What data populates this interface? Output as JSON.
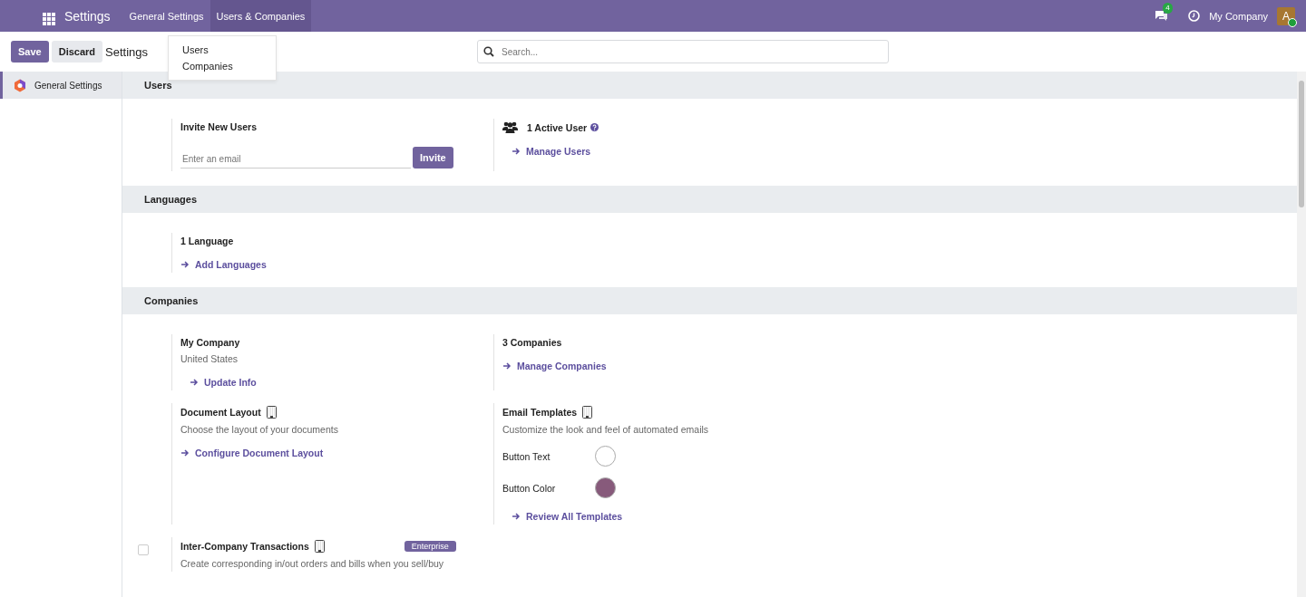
{
  "navbar": {
    "app_title": "Settings",
    "menu": [
      {
        "label": "General Settings",
        "selected": false
      },
      {
        "label": "Users & Companies",
        "selected": true
      }
    ],
    "messages_badge": "4",
    "company": "My Company",
    "avatar": "A",
    "online": true
  },
  "dropdown": {
    "items": [
      "Users",
      "Companies"
    ]
  },
  "control_panel": {
    "buttons": [
      {
        "label": "Save",
        "kind": "primary"
      },
      {
        "label": "Discard",
        "kind": "secondary"
      }
    ],
    "breadcrumb": "Settings",
    "search": {
      "placeholder": "Search..."
    }
  },
  "sidebar": {
    "items": [
      {
        "label": "General Settings",
        "selected": true
      }
    ]
  },
  "sections": [
    {
      "title": "Users",
      "settings": [
        {
          "kind": "invite",
          "title": "Invite New Users",
          "placeholder": "Enter an email",
          "button": "Invite"
        },
        {
          "kind": "users",
          "title": "1 Active User",
          "help": true,
          "link": "Manage Users"
        }
      ]
    },
    {
      "title": "Languages",
      "settings": [
        {
          "kind": "count",
          "title": "1 Language",
          "link": "Add Languages"
        }
      ]
    },
    {
      "title": "Companies",
      "settings": [
        {
          "kind": "company",
          "title": "My Company",
          "subtitle": "United States",
          "link": "Update Info"
        },
        {
          "kind": "count",
          "title": "3 Companies",
          "link": "Manage Companies"
        },
        {
          "kind": "doc",
          "title": "Document Layout",
          "description": "Choose the layout of your documents",
          "link": "Configure Document Layout"
        },
        {
          "kind": "email",
          "title": "Email Templates",
          "description": "Customize the look and feel of automated emails",
          "colors": [
            {
              "label": "Button Text",
              "color": "#ffffff"
            },
            {
              "label": "Button Color",
              "color": "#875a7b"
            }
          ],
          "link": "Review All Templates"
        },
        {
          "kind": "checkbox",
          "title": "Inter-Company Transactions",
          "checked": false,
          "badge": "Enterprise",
          "description": "Create corresponding in/out orders and bills when you sell/buy"
        }
      ]
    }
  ]
}
